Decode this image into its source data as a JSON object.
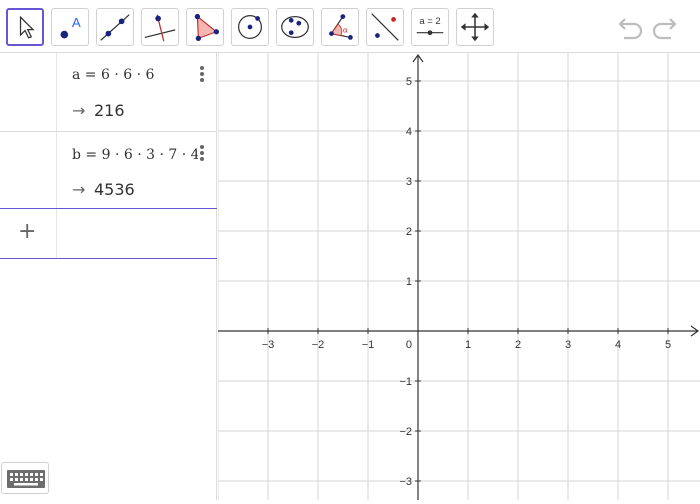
{
  "toolbar": {
    "tools": [
      {
        "name": "move-tool",
        "selected": true
      },
      {
        "name": "point-tool",
        "label": "A"
      },
      {
        "name": "line-tool"
      },
      {
        "name": "perpendicular-line-tool"
      },
      {
        "name": "polygon-tool"
      },
      {
        "name": "circle-center-point-tool"
      },
      {
        "name": "conic-five-points-tool"
      },
      {
        "name": "angle-tool",
        "label": "α"
      },
      {
        "name": "reflect-tool"
      },
      {
        "name": "slider-tool",
        "label": "a = 2"
      },
      {
        "name": "move-graphics-view-tool"
      }
    ],
    "undo_icon": "undo-icon",
    "redo_icon": "redo-icon"
  },
  "algebra": {
    "items": [
      {
        "definition": "a = 6 · 6 · 6",
        "output": "216"
      },
      {
        "definition": "b = 9 · 6 · 3 · 7 · 4",
        "output": "4536"
      }
    ],
    "arrow": "→",
    "add_icon": "+"
  },
  "graphics": {
    "x_ticks": [
      -3,
      -2,
      -1,
      1,
      2,
      3,
      4,
      5
    ],
    "y_ticks": [
      5,
      4,
      3,
      2,
      1,
      -1,
      -2,
      -3
    ],
    "origin_label": "0",
    "grid": true
  },
  "keyboard_icon": "keyboard-icon"
}
